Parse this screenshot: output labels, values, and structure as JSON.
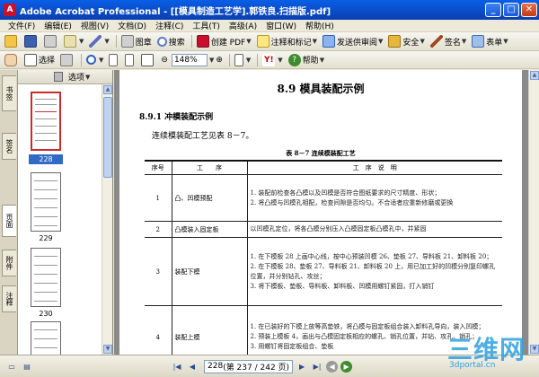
{
  "window": {
    "title": "Adobe Acrobat Professional - [[模具制造工艺学].郭铁良.扫描版.pdf]",
    "app_icon_label": "A"
  },
  "menu": [
    "文件(F)",
    "编辑(E)",
    "视图(V)",
    "文档(D)",
    "注释(C)",
    "工具(T)",
    "高级(A)",
    "窗口(W)",
    "帮助(H)"
  ],
  "toolbar1": {
    "gallery_label": "图章",
    "search_label": "搜索",
    "create_pdf_label": "创建 PDF",
    "comment_label": "注释和标记",
    "review_label": "发送供审阅",
    "security_label": "安全",
    "sign_label": "签名",
    "form_label": "表单"
  },
  "toolbar2": {
    "select_label": "选择",
    "zoom_value": "148%",
    "help_label": "帮助",
    "yahoo_label": "Y!"
  },
  "sidetabs": [
    "书签",
    "签名",
    "页面",
    "附件",
    "注释"
  ],
  "pages_panel": {
    "options_label": "选项",
    "thumbs": [
      {
        "num": "228",
        "selected": true
      },
      {
        "num": "229",
        "selected": false
      },
      {
        "num": "230",
        "selected": false
      },
      {
        "num": "",
        "selected": false
      }
    ]
  },
  "document": {
    "section_title": "8.9   模具装配示例",
    "subsection": "8.9.1   冲模装配示例",
    "intro": "连续模装配工艺见表 8－7。",
    "table_caption": "表 8－7   连续模装配工艺",
    "headers": [
      "序号",
      "工　　序",
      "工　序　说　明"
    ],
    "rows": [
      {
        "num": "1",
        "process": "凸、凹模预配",
        "desc": [
          "1. 装配前检查各凸模以及凹模是否符合图纸要求的尺寸精度、形状；",
          "2. 将凸模与凹模孔相配，检查间隙是否均匀。不合适者应重新修磨或更换"
        ]
      },
      {
        "num": "2",
        "process": "凸模装入固定板",
        "desc": [
          "以凹模孔定位，将各凸模分别压入凸模固定板凸模孔中，并紧固"
        ]
      },
      {
        "num": "3",
        "process": "装配下模",
        "desc": [
          "1. 在下模板 28 上画中心线，按中心预装凹模 26、垫板 27、导料板 21、卸料板 20；",
          "2. 在下模板 28、垫板 27、导料板 21、卸料板 20 上，用已加工好的凹模分别复印螺孔位置，并分别钻孔、攻丝；",
          "3. 将下模板、垫板、导料板、卸料板、凹模用螺钉紧固，打入销钉"
        ]
      },
      {
        "num": "4",
        "process": "装配上模",
        "desc": [
          "1. 在已装好的下模上放等高垫铁，将凸模与固定板组合装入卸料孔导向，装入凹模；",
          "2. 预装上模板 4，画出与凸模固定板相应的螺孔、销孔位置，并钻、攻孔、销孔；",
          "3. 用螺钉将固定板组合、垫板"
        ]
      }
    ]
  },
  "statusbar": {
    "page_field": "228",
    "page_display": "(第 237 / 242 页)"
  },
  "watermark": {
    "big": "三维网",
    "small": "3dportal.cn"
  },
  "colors": {
    "titlebar": "#0a5ee6",
    "selected_thumb": "#316ac5",
    "watermark": "#2fa0e0"
  }
}
